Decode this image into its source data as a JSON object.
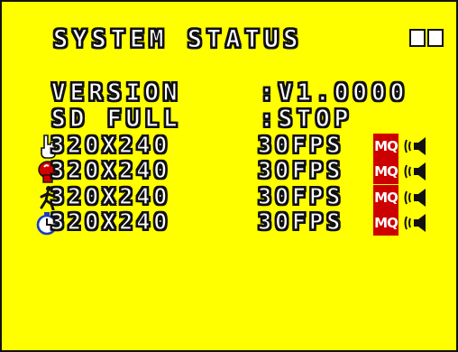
{
  "title": "SYSTEM STATUS",
  "info": [
    {
      "label": "VERSION",
      "value": ":V1.0000"
    },
    {
      "label": "SD FULL",
      "value": ":STOP"
    }
  ],
  "channels": [
    {
      "icon": "hand-pointer-icon",
      "resolution": "320X240",
      "fps": "30FPS",
      "quality": "MQ",
      "audio": "speaker-icon"
    },
    {
      "icon": "alarm-siren-icon",
      "resolution": "320X240",
      "fps": "30FPS",
      "quality": "MQ",
      "audio": "speaker-icon"
    },
    {
      "icon": "running-person-icon",
      "resolution": "320X240",
      "fps": "30FPS",
      "quality": "MQ",
      "audio": "speaker-icon"
    },
    {
      "icon": "clock-icon",
      "resolution": "320X240",
      "fps": "30FPS",
      "quality": "MQ",
      "audio": "speaker-icon"
    }
  ],
  "colors": {
    "background": "#ffff00",
    "text": "#ffffff",
    "outline": "#111111",
    "quality_badge": "#cc0000"
  }
}
